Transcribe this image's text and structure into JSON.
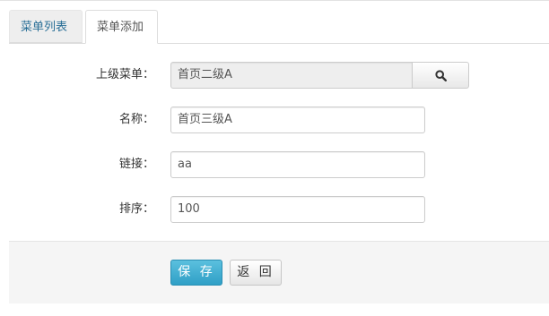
{
  "tabs": [
    {
      "label": "菜单列表",
      "active": false
    },
    {
      "label": "菜单添加",
      "active": true
    }
  ],
  "form": {
    "parent": {
      "label": "上级菜单：",
      "value": "首页二级A",
      "icon": "search-icon"
    },
    "name": {
      "label": "名称：",
      "value": "首页三级A"
    },
    "link": {
      "label": "链接：",
      "value": "aa"
    },
    "order": {
      "label": "排序：",
      "value": "100"
    }
  },
  "actions": {
    "save_label": "保 存",
    "back_label": "返 回"
  },
  "colors": {
    "primary": "#31b0d5",
    "link": "#2a6f97",
    "footer_bg": "#f5f5f5"
  }
}
